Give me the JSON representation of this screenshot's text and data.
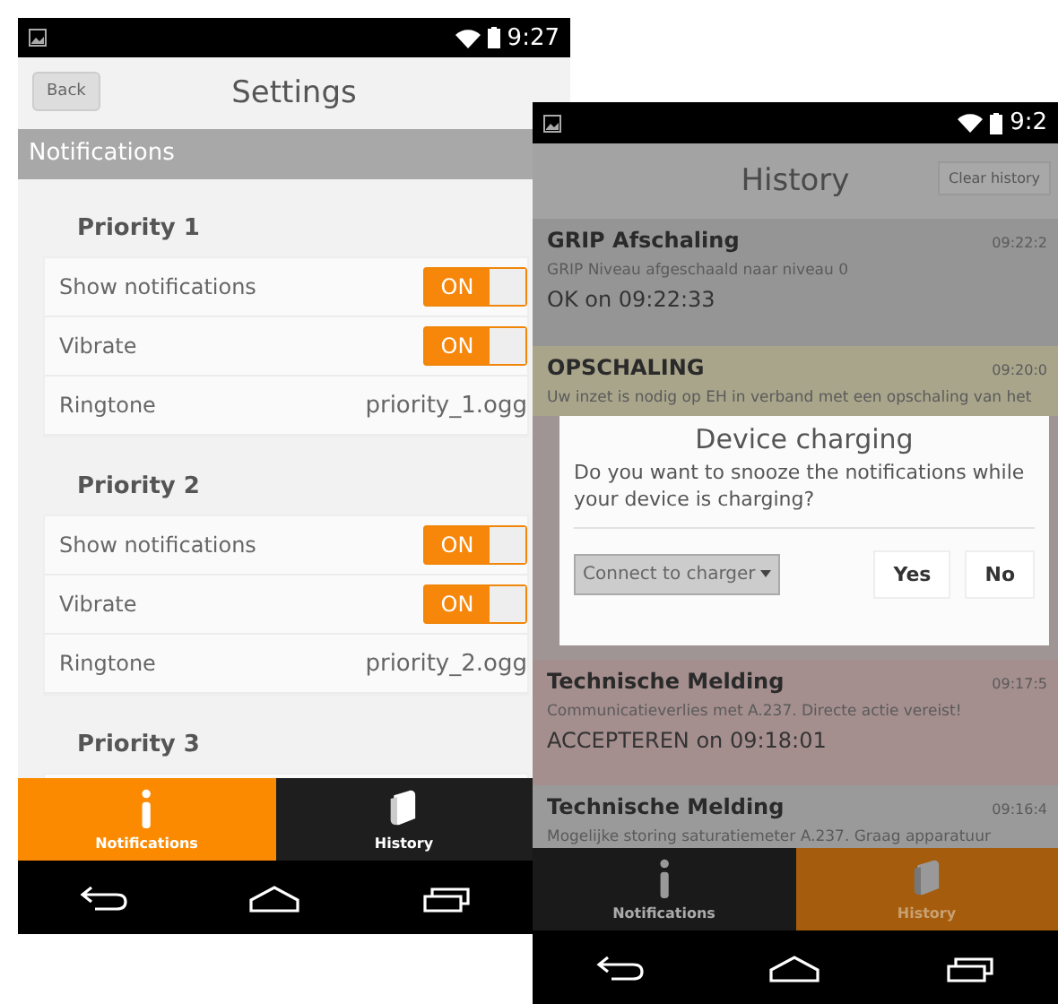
{
  "settings_phone": {
    "status_bar": {
      "time": "9:27"
    },
    "back_button": "Back",
    "title": "Settings",
    "section": "Notifications",
    "groups": [
      {
        "title": "Priority 1",
        "rows": [
          {
            "kind": "toggle",
            "label": "Show notifications",
            "on": true,
            "switch_text": "ON"
          },
          {
            "kind": "toggle",
            "label": "Vibrate",
            "on": true,
            "switch_text": "ON"
          },
          {
            "kind": "value",
            "label": "Ringtone",
            "value": "priority_1.ogg"
          }
        ]
      },
      {
        "title": "Priority 2",
        "rows": [
          {
            "kind": "toggle",
            "label": "Show notifications",
            "on": true,
            "switch_text": "ON"
          },
          {
            "kind": "toggle",
            "label": "Vibrate",
            "on": true,
            "switch_text": "ON"
          },
          {
            "kind": "value",
            "label": "Ringtone",
            "value": "priority_2.ogg"
          }
        ]
      },
      {
        "title": "Priority 3"
      }
    ],
    "tabs": [
      {
        "label": "Notifications",
        "selected": true
      },
      {
        "label": "History",
        "selected": false
      }
    ]
  },
  "history_phone": {
    "status_bar": {
      "time": "9:2"
    },
    "title": "History",
    "clear_button": "Clear history",
    "items": [
      {
        "title": "GRIP Afschaling",
        "time": "09:22:2",
        "message": "GRIP Niveau afgeschaald naar niveau 0",
        "response": "OK on 09:22:33",
        "color": "#959595"
      },
      {
        "title": "OPSCHALING",
        "time": "09:20:0",
        "message": "Uw inzet is nodig op EH in verband met een opschaling van het",
        "color": "#a9a58b"
      },
      {
        "title": "Technische Melding",
        "time": "09:17:5",
        "message": "Communicatieverlies met A.237. Directe actie vereist!",
        "response": "ACCEPTEREN on 09:18:01",
        "color": "#a58e8e"
      },
      {
        "title": "Technische Melding",
        "time": "09:16:4",
        "message": "Mogelijke storing saturatiemeter A.237. Graag apparatuur",
        "color": "#9a9a9a"
      }
    ],
    "tabs": [
      {
        "label": "Notifications",
        "selected": false
      },
      {
        "label": "History",
        "selected": true
      }
    ],
    "dialog": {
      "title": "Device charging",
      "message": "Do you want to snooze the notifications while your device is charging?",
      "dropdown": "Connect to charger",
      "buttons": [
        "Yes",
        "No"
      ]
    }
  }
}
